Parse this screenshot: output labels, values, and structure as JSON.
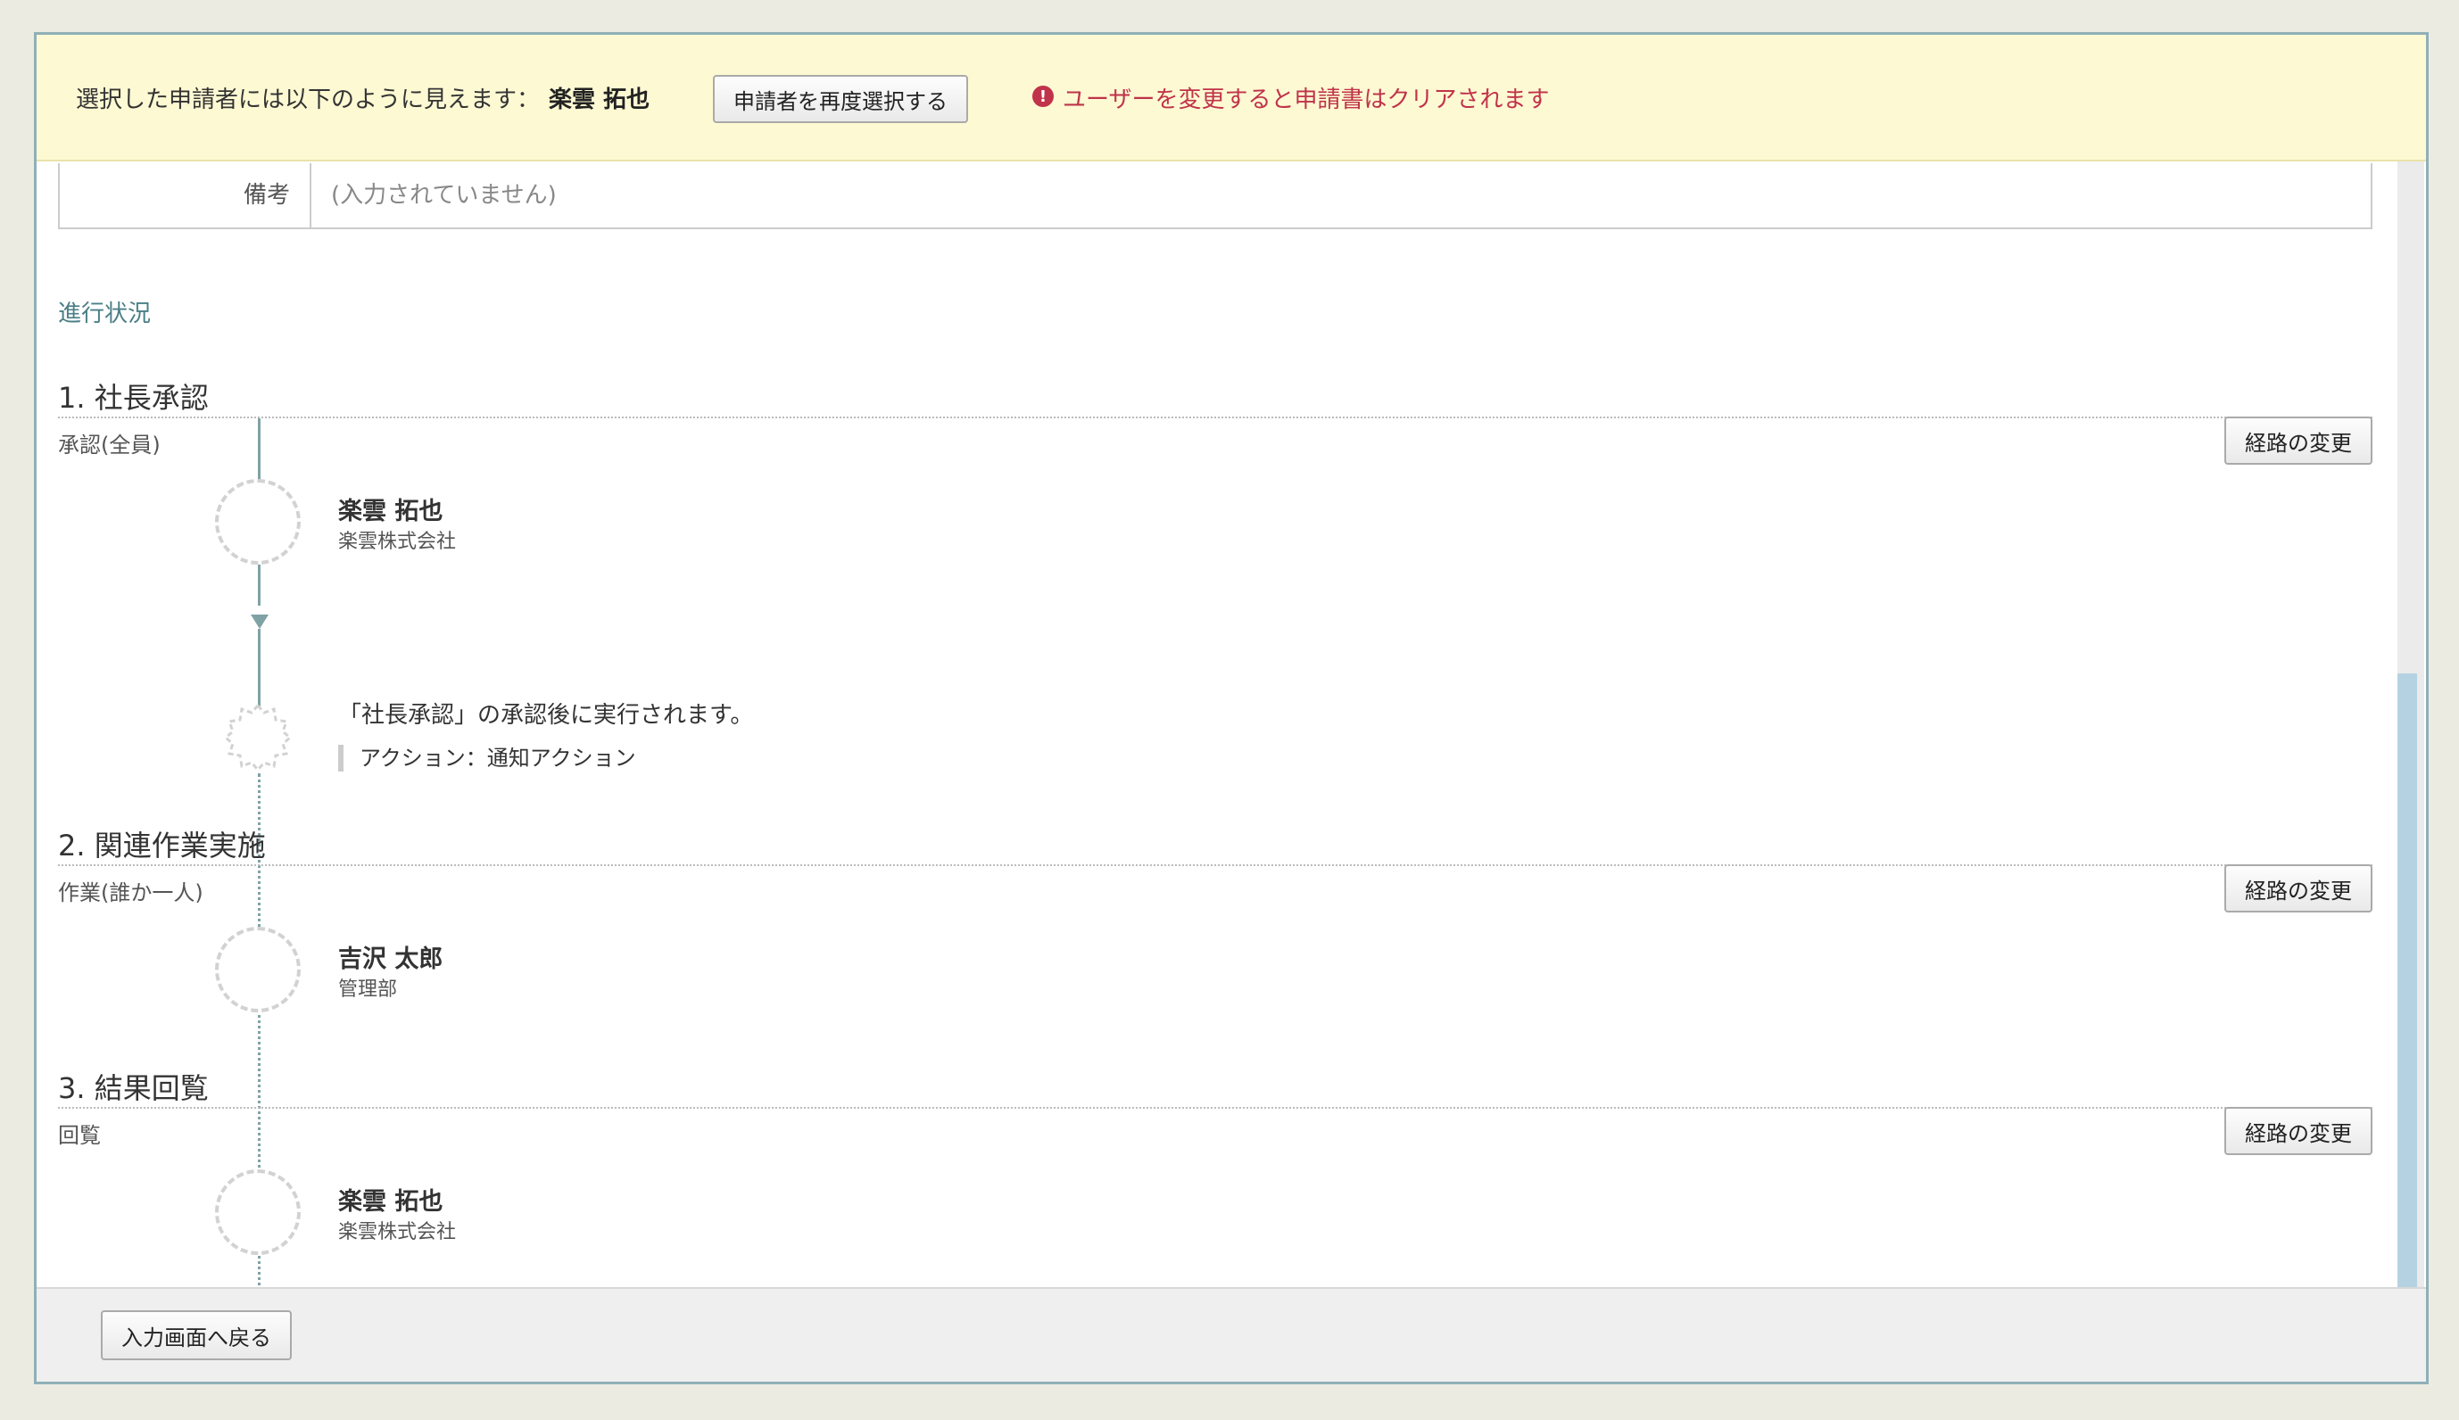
{
  "banner": {
    "selected_label": "選択した申請者には以下のように見えます：",
    "selected_name": "楽雲 拓也",
    "reselect_button": "申請者を再度選択する",
    "warning_icon": "!",
    "warning_text": "ユーザーを変更すると申請書はクリアされます"
  },
  "note": {
    "label": "備考",
    "value": "(入力されていません)"
  },
  "progress": {
    "title": "進行状況",
    "route_button": "経路の変更",
    "steps": [
      {
        "heading": "1. 社長承認",
        "type": "承認(全員)",
        "person": {
          "name": "楽雲 拓也",
          "org": "楽雲株式会社"
        },
        "action": {
          "text": "「社長承認」の承認後に実行されます。",
          "detail": "アクション：通知アクション"
        }
      },
      {
        "heading": "2. 関連作業実施",
        "type": "作業(誰か一人)",
        "person": {
          "name": "吉沢 太郎",
          "org": "管理部"
        }
      },
      {
        "heading": "3. 結果回覧",
        "type": "回覧",
        "person": {
          "name": "楽雲 拓也",
          "org": "楽雲株式会社"
        }
      }
    ]
  },
  "footer": {
    "back_button": "入力画面へ戻る"
  },
  "colors": {
    "banner_bg": "#fdf9d3",
    "warning": "#c0334a",
    "accent": "#4a7f86",
    "line": "#7fa2a5"
  }
}
